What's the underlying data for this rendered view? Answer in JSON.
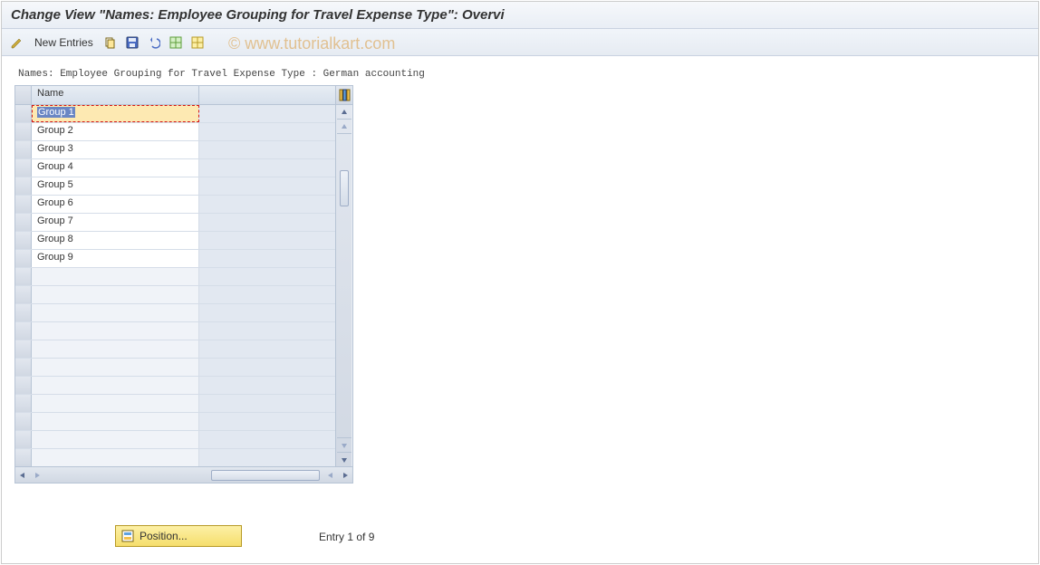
{
  "header": {
    "title": "Change View \"Names: Employee Grouping for Travel Expense Type\": Overvi"
  },
  "toolbar": {
    "new_entries": "New Entries"
  },
  "watermark": "© www.tutorialkart.com",
  "table": {
    "subtitle": "Names: Employee Grouping for Travel Expense Type : German accounting",
    "columns": [
      "Name"
    ],
    "rows": [
      {
        "name": "Group 1",
        "editing": true
      },
      {
        "name": "Group 2",
        "editing": false
      },
      {
        "name": "Group 3",
        "editing": false
      },
      {
        "name": "Group 4",
        "editing": false
      },
      {
        "name": "Group 5",
        "editing": false
      },
      {
        "name": "Group 6",
        "editing": false
      },
      {
        "name": "Group 7",
        "editing": false
      },
      {
        "name": "Group 8",
        "editing": false
      },
      {
        "name": "Group 9",
        "editing": false
      }
    ],
    "empty_rows": 11
  },
  "footer": {
    "position_label": "Position...",
    "entry_text": "Entry 1 of 9"
  }
}
